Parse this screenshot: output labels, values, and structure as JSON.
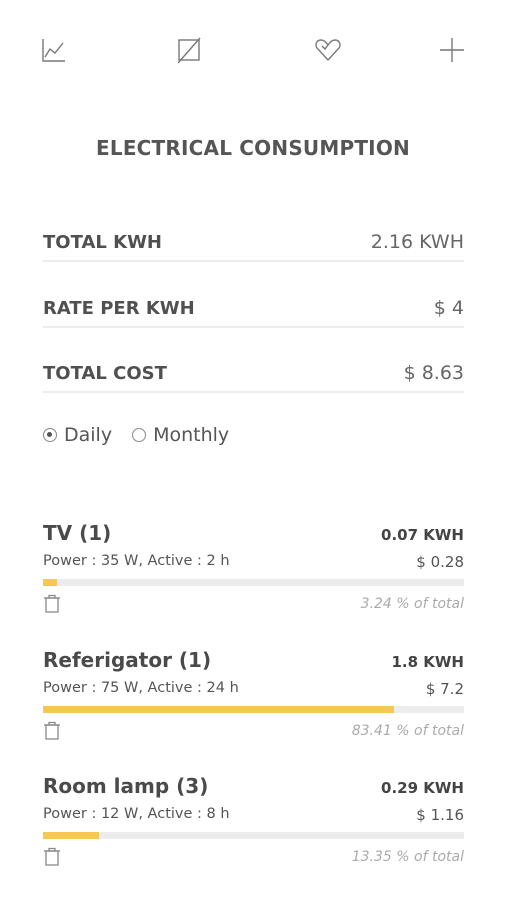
{
  "toolbar": {
    "icons": [
      "chart-icon",
      "edit-disabled-icon",
      "heart-icon",
      "add-icon"
    ]
  },
  "title": "ELECTRICAL CONSUMPTION",
  "stats": {
    "total_kwh": {
      "label": "TOTAL KWH",
      "value": "2.16 KWH"
    },
    "rate_per_kwh": {
      "label": "RATE PER KWH",
      "value": "$ 4"
    },
    "total_cost": {
      "label": "TOTAL COST",
      "value": "$ 8.63"
    }
  },
  "period": {
    "options": [
      {
        "label": "Daily",
        "selected": true
      },
      {
        "label": "Monthly",
        "selected": false
      }
    ]
  },
  "devices": [
    {
      "name": "TV (1)",
      "meta": "Power : 35 W, Active : 2 h",
      "kwh": "0.07 KWH",
      "cost": "$ 0.28",
      "percent_text": "3.24 % of total",
      "share": 3.24
    },
    {
      "name": "Referigator (1)",
      "meta": "Power : 75 W, Active : 24 h",
      "kwh": "1.8 KWH",
      "cost": "$ 7.2",
      "percent_text": "83.41 % of total",
      "share": 83.41
    },
    {
      "name": "Room lamp (3)",
      "meta": "Power : 12 W, Active : 8 h",
      "kwh": "0.29 KWH",
      "cost": "$ 1.16",
      "percent_text": "13.35 % of total",
      "share": 13.35
    }
  ],
  "colors": {
    "accent": "#f6c84f",
    "track": "#ececec",
    "text": "#444444"
  }
}
